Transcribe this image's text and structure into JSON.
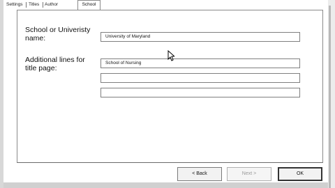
{
  "tabs": [
    {
      "label": "Settings"
    },
    {
      "label": "Titles"
    },
    {
      "label": "Author"
    },
    {
      "label": "School"
    }
  ],
  "active_tab": "School",
  "form": {
    "school_label": "School or Univeristy name:",
    "school_value": "University of Maryland",
    "additional_label": "Additional lines for title page:",
    "additional_lines": [
      "School of Nursing",
      "",
      ""
    ]
  },
  "buttons": {
    "back": "< Back",
    "next": "Next >",
    "ok": "OK"
  },
  "icons": {
    "cursor": "mouse-pointer-icon"
  }
}
